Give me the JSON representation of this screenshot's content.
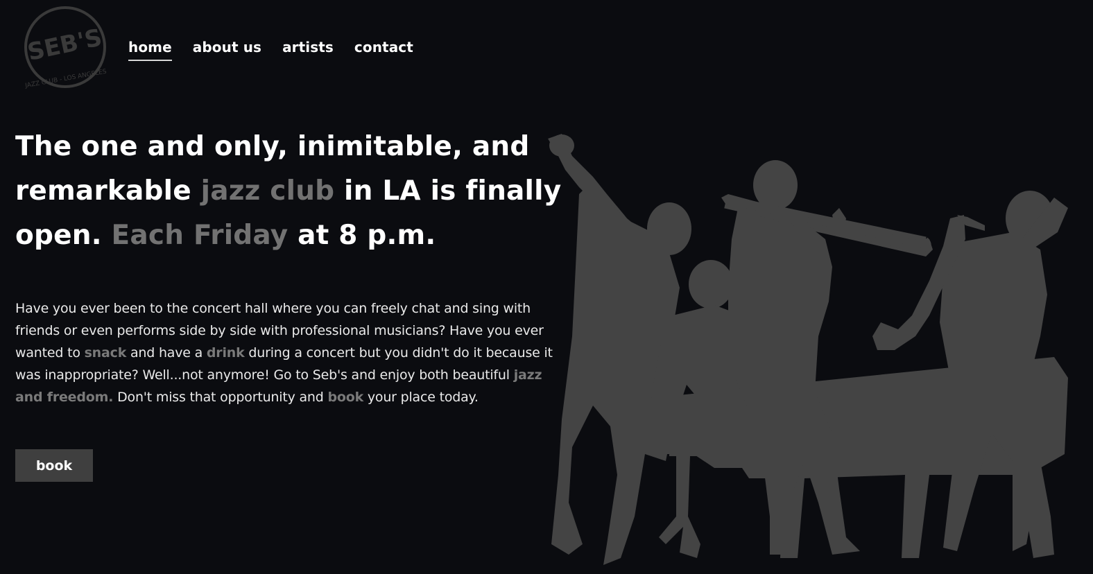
{
  "logo": {
    "brand_text": "SEB'S",
    "sub_text": "JAZZ CLUB - LOS ANGELES"
  },
  "nav": {
    "items": [
      {
        "label": "home",
        "active": true
      },
      {
        "label": "about us",
        "active": false
      },
      {
        "label": "artists",
        "active": false
      },
      {
        "label": "contact",
        "active": false
      }
    ]
  },
  "hero": {
    "headline": {
      "part1": "The one and only, inimitable, and remarkable ",
      "highlight1": "jazz club",
      "part2": " in LA is finally open. ",
      "highlight2": "Each Friday",
      "part3": " at 8 p.m."
    },
    "description": {
      "t1": "Have you ever been to the concert hall where you can freely chat and sing with friends or even performs side by side with professional musicians? Have you ever wanted to ",
      "e1": "snack",
      "t2": " and have a ",
      "e2": "drink",
      "t3": " during a concert but you didn't do it because it was inappropriate? Well...not anymore! Go to Seb's and enjoy both beautiful ",
      "e3": "jazz and freedom.",
      "t4": " Don't miss that opportunity and ",
      "e4": "book",
      "t5": " your place today."
    },
    "book_button": "book"
  },
  "colors": {
    "background": "#0b0c10",
    "highlight": "#727272",
    "silhouette": "#444444",
    "button": "#3f3f3f"
  }
}
